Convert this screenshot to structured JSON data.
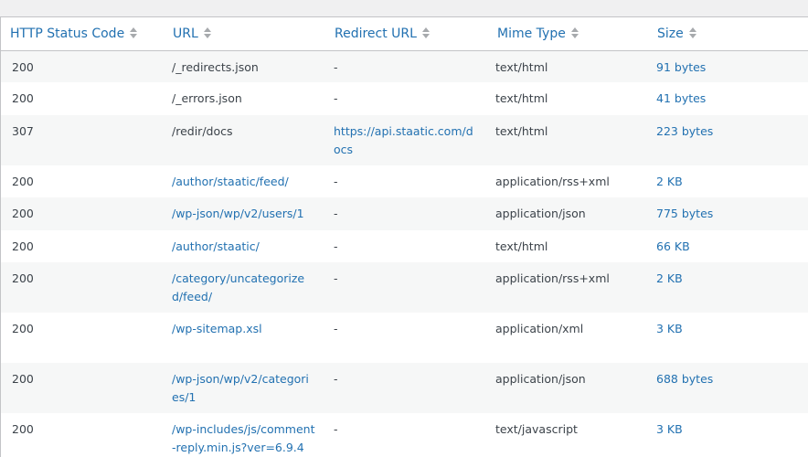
{
  "columns": [
    {
      "label": "HTTP Status Code"
    },
    {
      "label": "URL"
    },
    {
      "label": "Redirect URL"
    },
    {
      "label": "Mime Type"
    },
    {
      "label": "Size"
    }
  ],
  "rows": [
    {
      "status": "200",
      "url": "/_redirects.json",
      "url_is_link": false,
      "redirect": "-",
      "redirect_is_link": false,
      "mime": "text/html",
      "size": "91 bytes"
    },
    {
      "status": "200",
      "url": "/_errors.json",
      "url_is_link": false,
      "redirect": "-",
      "redirect_is_link": false,
      "mime": "text/html",
      "size": "41 bytes"
    },
    {
      "status": "307",
      "url": "/redir/docs",
      "url_is_link": false,
      "redirect": "https://api.staatic.com/docs",
      "redirect_is_link": true,
      "mime": "text/html",
      "size": "223 bytes"
    },
    {
      "status": "200",
      "url": "/author/staatic/feed/",
      "url_is_link": true,
      "redirect": "-",
      "redirect_is_link": false,
      "mime": "application/rss+xml",
      "size": "2 KB"
    },
    {
      "status": "200",
      "url": "/wp-json/wp/v2/users/1",
      "url_is_link": true,
      "redirect": "-",
      "redirect_is_link": false,
      "mime": "application/json",
      "size": "775 bytes"
    },
    {
      "status": "200",
      "url": "/author/staatic/",
      "url_is_link": true,
      "redirect": "-",
      "redirect_is_link": false,
      "mime": "text/html",
      "size": "66 KB"
    },
    {
      "status": "200",
      "url": "/category/uncategorized/feed/",
      "url_is_link": true,
      "redirect": "-",
      "redirect_is_link": false,
      "mime": "application/rss+xml",
      "size": "2 KB"
    },
    {
      "status": "200",
      "url": "/wp-sitemap.xsl",
      "url_is_link": true,
      "redirect": "-",
      "redirect_is_link": false,
      "mime": "application/xml",
      "size": "3 KB"
    },
    {
      "status": "200",
      "url": "/wp-json/wp/v2/categories/1",
      "url_is_link": true,
      "redirect": "-",
      "redirect_is_link": false,
      "mime": "application/json",
      "size": "688 bytes"
    },
    {
      "status": "200",
      "url": "/wp-includes/js/comment-reply.min.js?ver=6.9.4",
      "url_is_link": true,
      "redirect": "-",
      "redirect_is_link": false,
      "mime": "text/javascript",
      "size": "3 KB"
    }
  ],
  "colors": {
    "link": "#2271b1",
    "text": "#3c434a",
    "stripe": "#f6f7f7",
    "background": "#f0f0f1"
  }
}
